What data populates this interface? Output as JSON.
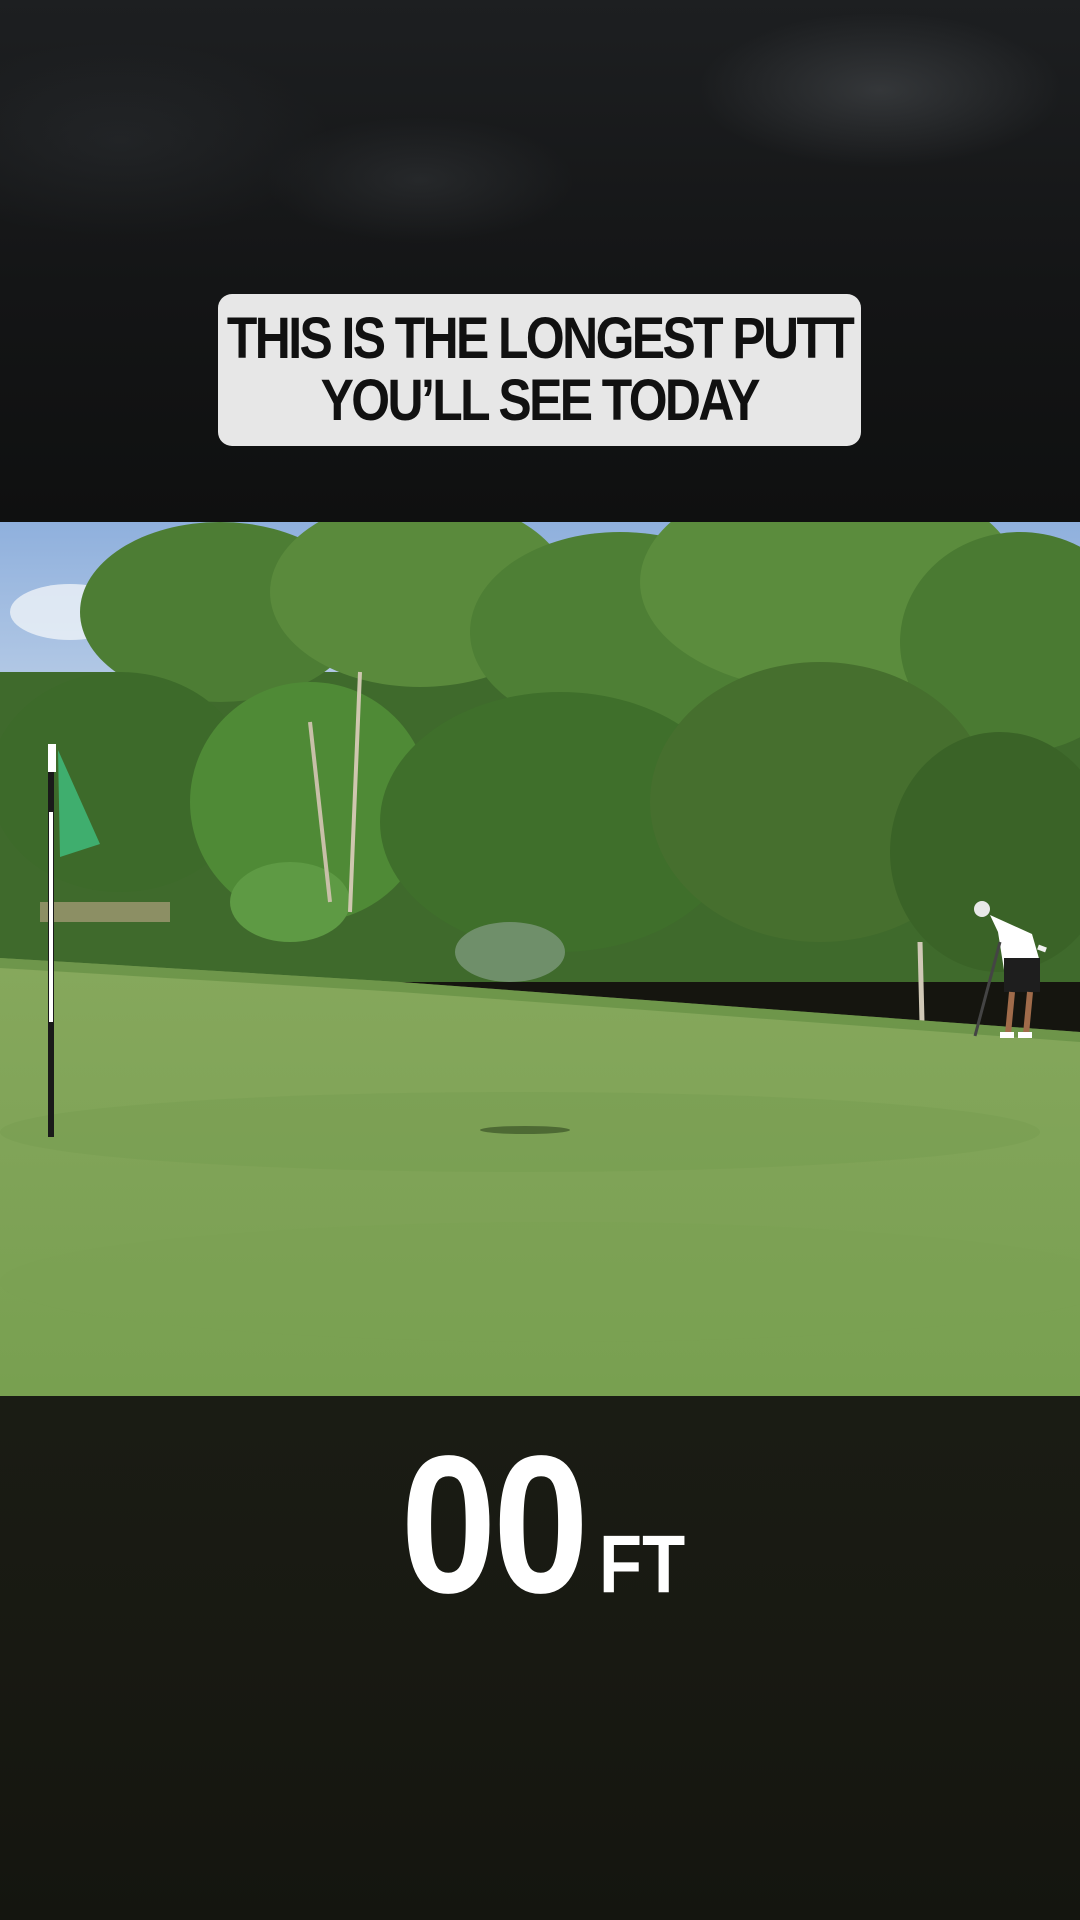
{
  "caption": {
    "line1": "THIS IS THE LONGEST PUTT",
    "line2": "YOU’LL SEE TODAY"
  },
  "distance": {
    "value": "00",
    "unit": "FT"
  },
  "colors": {
    "caption_bg": "#e7e7e7",
    "caption_text": "#111111",
    "overlay_text": "#ffffff",
    "green": "#7fa658",
    "flag": "#3fae6e"
  },
  "icons": {
    "flagstick": "golf-flag-icon"
  }
}
